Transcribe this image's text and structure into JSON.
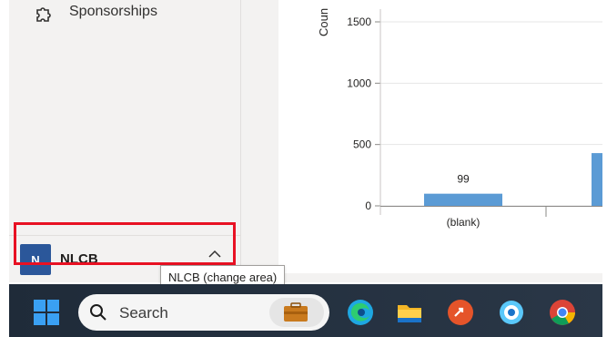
{
  "sidebar": {
    "items": [
      {
        "label": "Sponsorships",
        "icon": "puzzle-icon"
      }
    ],
    "area": {
      "avatar_letter": "N",
      "name": "NLCB",
      "avatar_color": "#2b579a",
      "tooltip": "NLCB (change area)"
    }
  },
  "chart_data": {
    "type": "bar",
    "ylabel": "Coun",
    "yticks": [
      "0",
      "500",
      "1000",
      "1500"
    ],
    "ylim": [
      0,
      1700
    ],
    "categories": [
      "(blank)",
      ""
    ],
    "values": [
      99,
      430
    ],
    "data_labels": [
      "99",
      ""
    ],
    "bar_color": "#5b9bd5",
    "grid": true
  },
  "taskbar": {
    "search_label": "Search",
    "apps": [
      "edge-icon",
      "file-explorer-icon",
      "remote-desktop-icon",
      "location-app-icon",
      "chrome-icon"
    ]
  },
  "colors": {
    "highlight": "#e81123",
    "taskbar": "#1f2b39"
  }
}
